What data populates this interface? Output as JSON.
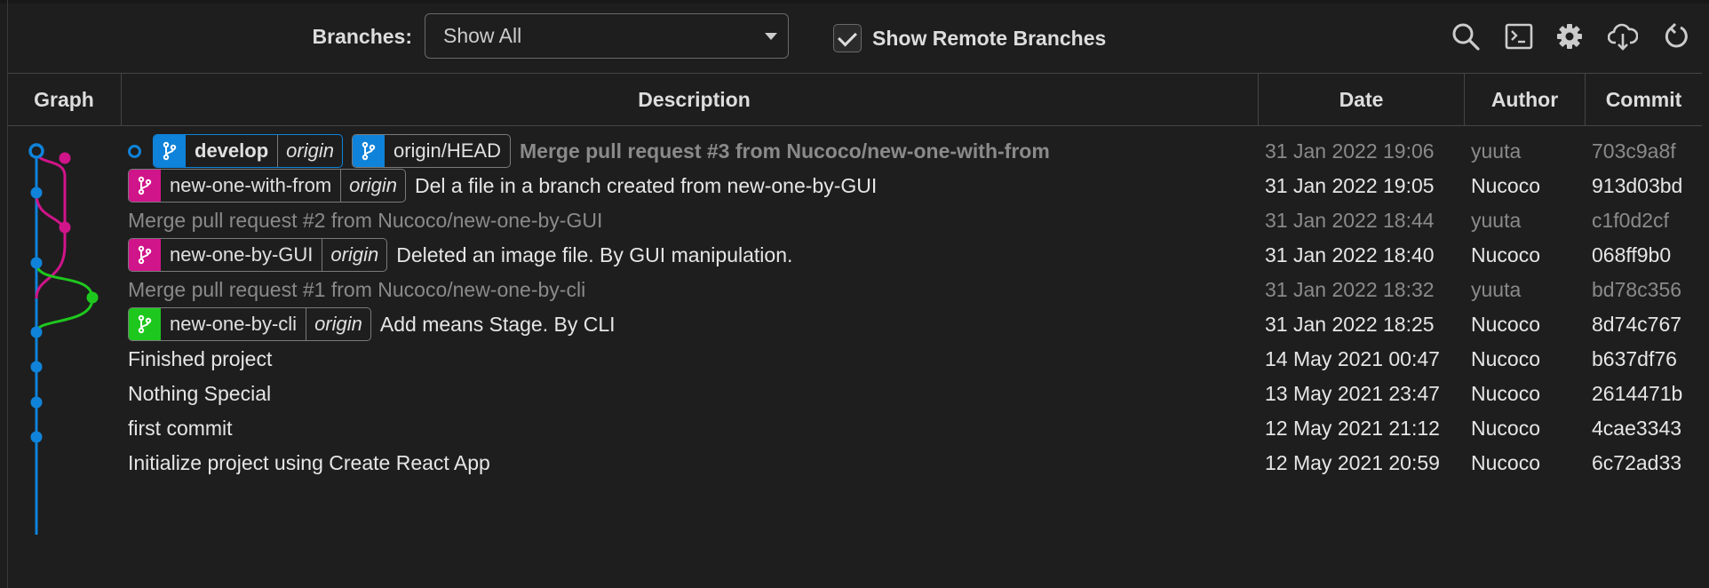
{
  "toolbar": {
    "branches_label": "Branches:",
    "branches_value": "Show All",
    "show_remote_label": "Show Remote Branches",
    "show_remote_checked": true,
    "icons": [
      "search-icon",
      "terminal-icon",
      "gear-icon",
      "cloud-download-icon",
      "refresh-icon"
    ]
  },
  "columns": {
    "graph": "Graph",
    "description": "Description",
    "date": "Date",
    "author": "Author",
    "commit": "Commit"
  },
  "colors": {
    "develop": "#0f83d9",
    "new_one_with_from": "#d0148a",
    "new_one_by_gui": "#d0148a",
    "new_one_by_cli": "#1ec71e"
  },
  "commits": [
    {
      "refs": [
        {
          "name": "develop",
          "remote": "origin",
          "bold": true
        },
        {
          "name": "origin/HEAD"
        }
      ],
      "message": "Merge pull request #3 from Nucoco/new-one-with-from",
      "date": "31 Jan 2022 19:06",
      "author": "yuuta",
      "hash": "703c9a8f"
    },
    {
      "refs": [
        {
          "name": "new-one-with-from",
          "remote": "origin"
        }
      ],
      "message": "Del a file in a branch created from new-one-by-GUI",
      "date": "31 Jan 2022 19:05",
      "author": "Nucoco",
      "hash": "913d03bd"
    },
    {
      "message": "Merge pull request #2 from Nucoco/new-one-by-GUI",
      "date": "31 Jan 2022 18:44",
      "author": "yuuta",
      "hash": "c1f0d2cf"
    },
    {
      "refs": [
        {
          "name": "new-one-by-GUI",
          "remote": "origin"
        }
      ],
      "message": "Deleted an image file. By GUI manipulation.",
      "date": "31 Jan 2022 18:40",
      "author": "Nucoco",
      "hash": "068ff9b0"
    },
    {
      "message": "Merge pull request #1 from Nucoco/new-one-by-cli",
      "date": "31 Jan 2022 18:32",
      "author": "yuuta",
      "hash": "bd78c356"
    },
    {
      "refs": [
        {
          "name": "new-one-by-cli",
          "remote": "origin"
        }
      ],
      "message": "Add means Stage. By CLI",
      "date": "31 Jan 2022 18:25",
      "author": "Nucoco",
      "hash": "8d74c767"
    },
    {
      "message": "Finished project",
      "date": "14 May 2021 00:47",
      "author": "Nucoco",
      "hash": "b637df76"
    },
    {
      "message": "Nothing Special",
      "date": "13 May 2021 23:47",
      "author": "Nucoco",
      "hash": "2614471b"
    },
    {
      "message": "first commit",
      "date": "12 May 2021 21:12",
      "author": "Nucoco",
      "hash": "4cae3343"
    },
    {
      "message": "Initialize project using Create React App",
      "date": "12 May 2021 20:59",
      "author": "Nucoco",
      "hash": "6c72ad33"
    }
  ]
}
